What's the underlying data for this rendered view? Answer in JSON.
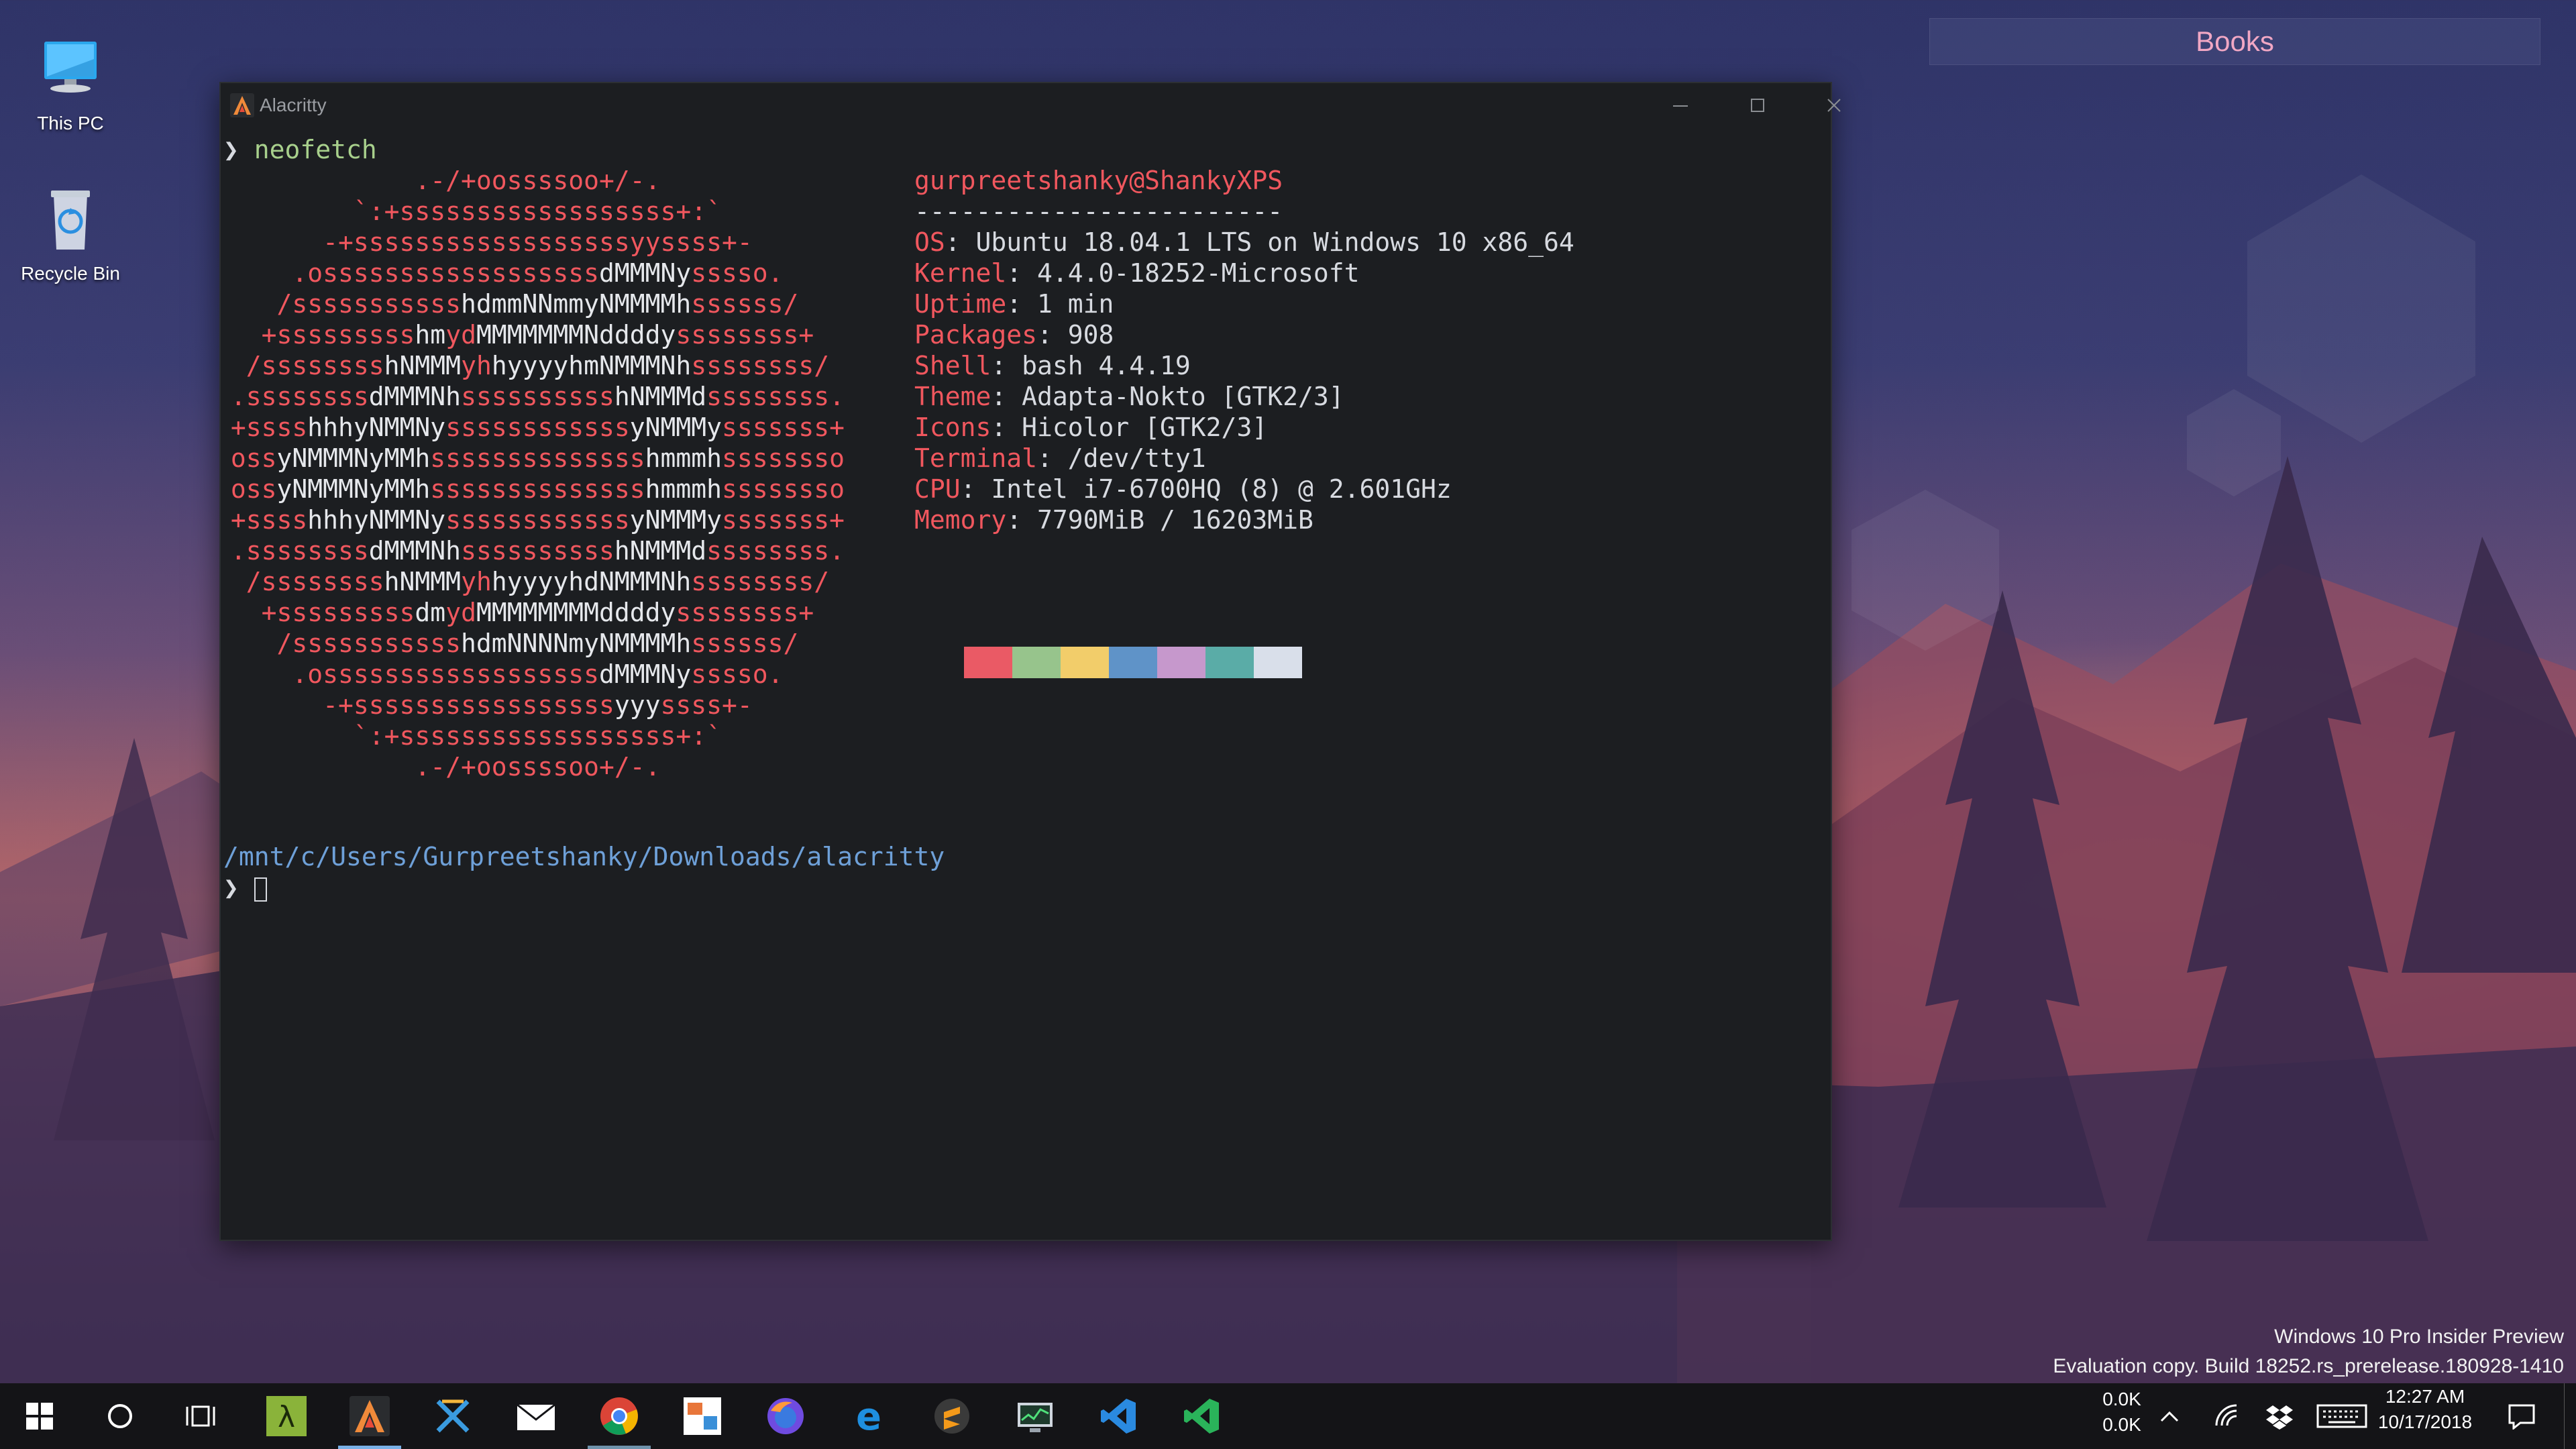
{
  "desktop": {
    "icons": [
      {
        "label": "This PC"
      },
      {
        "label": "Recycle Bin"
      }
    ],
    "widget": {
      "label": "Books"
    }
  },
  "window": {
    "title": "Alacritty",
    "controls": [
      "minimize",
      "maximize",
      "close"
    ]
  },
  "terminal": {
    "prompt_symbol": "❯",
    "command": "neofetch",
    "ascii_logo": [
      [
        [
          "r",
          "             .-/+oossssoo+/-."
        ]
      ],
      [
        [
          "r",
          "         `:+ssssssssssssssssss+:`"
        ]
      ],
      [
        [
          "r",
          "       -+ssssssssssssssssssyyssss+-"
        ]
      ],
      [
        [
          "r",
          "     .ossssssssssssssssss"
        ],
        [
          "w",
          "dMMMNy"
        ],
        [
          "r",
          "sssso."
        ]
      ],
      [
        [
          "r",
          "    /sssssssssss"
        ],
        [
          "w",
          "hdmmNNmmyNMMMMh"
        ],
        [
          "r",
          "ssssss/"
        ]
      ],
      [
        [
          "r",
          "   +sssssssss"
        ],
        [
          "w",
          "hm"
        ],
        [
          "r",
          "yd"
        ],
        [
          "w",
          "MMMMMMMNddddy"
        ],
        [
          "r",
          "ssssssss+"
        ]
      ],
      [
        [
          "r",
          "  /ssssssss"
        ],
        [
          "w",
          "hNMMM"
        ],
        [
          "r",
          "yh"
        ],
        [
          "w",
          "hyyyyhmNMMMNh"
        ],
        [
          "r",
          "ssssssss/"
        ]
      ],
      [
        [
          "r",
          " .ssssssss"
        ],
        [
          "w",
          "dMMMNh"
        ],
        [
          "r",
          "ssssssssss"
        ],
        [
          "w",
          "hNMMMd"
        ],
        [
          "r",
          "ssssssss."
        ]
      ],
      [
        [
          "r",
          " +ssss"
        ],
        [
          "w",
          "hhhyNMMNy"
        ],
        [
          "r",
          "ssssssssssss"
        ],
        [
          "w",
          "yNMMMy"
        ],
        [
          "r",
          "sssssss+"
        ]
      ],
      [
        [
          "r",
          " oss"
        ],
        [
          "w",
          "yNMMMNyMMh"
        ],
        [
          "r",
          "ssssssssssssss"
        ],
        [
          "w",
          "hmmmh"
        ],
        [
          "r",
          "ssssssso"
        ]
      ],
      [
        [
          "r",
          " oss"
        ],
        [
          "w",
          "yNMMMNyMMh"
        ],
        [
          "r",
          "ssssssssssssss"
        ],
        [
          "w",
          "hmmmh"
        ],
        [
          "r",
          "ssssssso"
        ]
      ],
      [
        [
          "r",
          " +ssss"
        ],
        [
          "w",
          "hhhyNMMNy"
        ],
        [
          "r",
          "ssssssssssss"
        ],
        [
          "w",
          "yNMMMy"
        ],
        [
          "r",
          "sssssss+"
        ]
      ],
      [
        [
          "r",
          " .ssssssss"
        ],
        [
          "w",
          "dMMMNh"
        ],
        [
          "r",
          "ssssssssss"
        ],
        [
          "w",
          "hNMMMd"
        ],
        [
          "r",
          "ssssssss."
        ]
      ],
      [
        [
          "r",
          "  /ssssssss"
        ],
        [
          "w",
          "hNMMM"
        ],
        [
          "r",
          "yh"
        ],
        [
          "w",
          "hyyyyhdNMMMNh"
        ],
        [
          "r",
          "ssssssss/"
        ]
      ],
      [
        [
          "r",
          "   +sssssssss"
        ],
        [
          "w",
          "dm"
        ],
        [
          "r",
          "yd"
        ],
        [
          "w",
          "MMMMMMMMddddy"
        ],
        [
          "r",
          "ssssssss+"
        ]
      ],
      [
        [
          "r",
          "    /sssssssssss"
        ],
        [
          "w",
          "hdmNNNNmyNMMMMh"
        ],
        [
          "r",
          "ssssss/"
        ]
      ],
      [
        [
          "r",
          "     .ossssssssssssssssss"
        ],
        [
          "w",
          "dMMMNy"
        ],
        [
          "r",
          "sssso."
        ]
      ],
      [
        [
          "r",
          "       -+sssssssssssssssss"
        ],
        [
          "w",
          "yyy"
        ],
        [
          "r",
          "ssss+-"
        ]
      ],
      [
        [
          "r",
          "         `:+ssssssssssssssssss+:`"
        ]
      ],
      [
        [
          "r",
          "             .-/+oossssoo+/-."
        ]
      ]
    ],
    "info_header": "gurpreetshanky@ShankyXPS",
    "info_separator": "------------------------",
    "info": [
      {
        "key": "OS",
        "value": ": Ubuntu 18.04.1 LTS on Windows 10 x86_64"
      },
      {
        "key": "Kernel",
        "value": ": 4.4.0-18252-Microsoft"
      },
      {
        "key": "Uptime",
        "value": ": 1 min"
      },
      {
        "key": "Packages",
        "value": ": 908"
      },
      {
        "key": "Shell",
        "value": ": bash 4.4.19"
      },
      {
        "key": "Theme",
        "value": ": Adapta-Nokto [GTK2/3]"
      },
      {
        "key": "Icons",
        "value": ": Hicolor [GTK2/3]"
      },
      {
        "key": "Terminal",
        "value": ": /dev/tty1"
      },
      {
        "key": "CPU",
        "value": ": Intel i7-6700HQ (8) @ 2.601GHz"
      },
      {
        "key": "Memory",
        "value": ": 7790MiB / 16203MiB"
      }
    ],
    "palette": [
      "#ea5a65",
      "#97c48c",
      "#f2cd6a",
      "#5f93c8",
      "#c698cc",
      "#5aaca7",
      "#d9dfea"
    ],
    "cwd": "/mnt/c/Users/Gurpreetshanky/Downloads/alacritty"
  },
  "watermark": {
    "line1": "Windows 10 Pro Insider Preview",
    "line2": "Evaluation copy. Build 18252.rs_prerelease.180928-1410"
  },
  "taskbar": {
    "apps": [
      {
        "name": "start-icon"
      },
      {
        "name": "cortana-icon"
      },
      {
        "name": "task-view-icon"
      },
      {
        "name": "lambda-app-icon"
      },
      {
        "name": "alacritty-icon"
      },
      {
        "name": "xming-icon"
      },
      {
        "name": "mail-icon"
      },
      {
        "name": "chrome-icon"
      },
      {
        "name": "photo-app-icon"
      },
      {
        "name": "firefox-icon"
      },
      {
        "name": "edge-icon"
      },
      {
        "name": "sublime-text-icon"
      },
      {
        "name": "task-manager-icon"
      },
      {
        "name": "vscode-icon"
      },
      {
        "name": "vscode-insiders-icon"
      }
    ],
    "net_up": "0.0K",
    "net_down": "0.0K",
    "time": "12:27 AM",
    "date": "10/17/2018"
  }
}
